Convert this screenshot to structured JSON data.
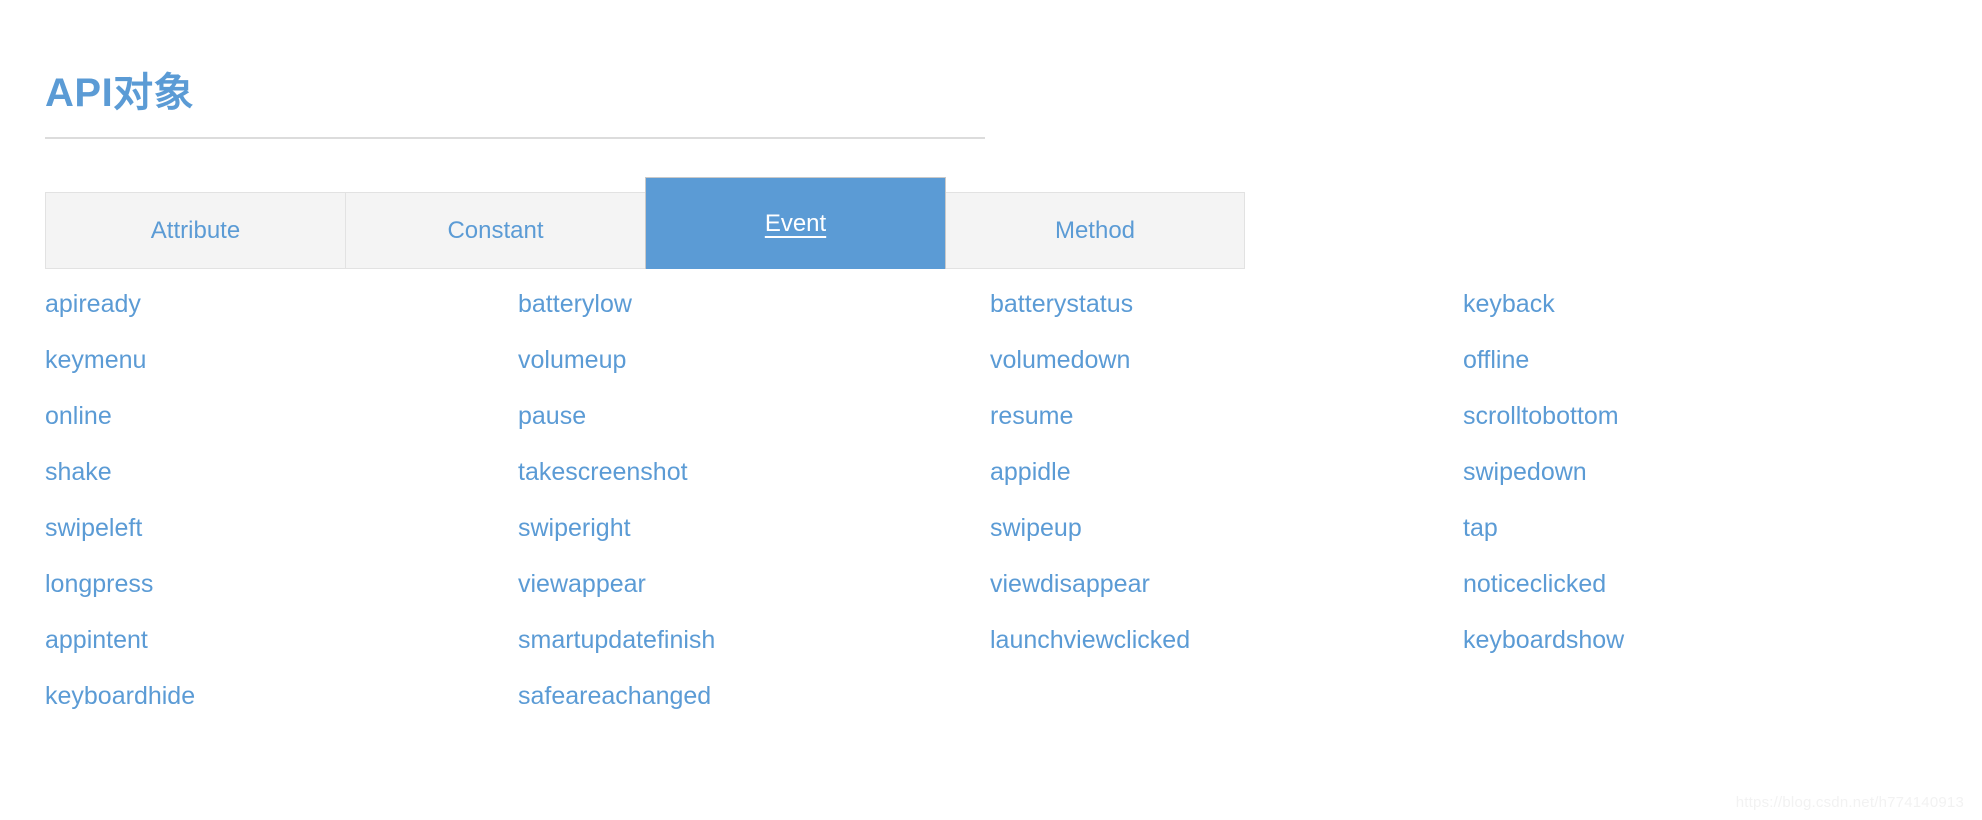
{
  "header": {
    "title": "API对象",
    "title_color": "#5b9bd5",
    "rule_color": "#dcdcdc"
  },
  "tabs": {
    "active_index": 2,
    "active_bg": "#5b9bd5",
    "inactive_bg": "#f4f4f4",
    "items": [
      {
        "label": "Attribute"
      },
      {
        "label": "Constant"
      },
      {
        "label": "Event"
      },
      {
        "label": "Method"
      }
    ]
  },
  "event_list": {
    "columns": [
      {
        "items": [
          {
            "label": "apiready"
          },
          {
            "label": "keymenu"
          },
          {
            "label": "online"
          },
          {
            "label": "shake"
          },
          {
            "label": "swipeleft"
          },
          {
            "label": "longpress"
          },
          {
            "label": "appintent"
          },
          {
            "label": "keyboardhide"
          }
        ]
      },
      {
        "items": [
          {
            "label": "batterylow"
          },
          {
            "label": "volumeup"
          },
          {
            "label": "pause"
          },
          {
            "label": "takescreenshot"
          },
          {
            "label": "swiperight"
          },
          {
            "label": "viewappear"
          },
          {
            "label": "smartupdatefinish"
          },
          {
            "label": "safeareachanged"
          }
        ]
      },
      {
        "items": [
          {
            "label": "batterystatus"
          },
          {
            "label": "volumedown"
          },
          {
            "label": "resume"
          },
          {
            "label": "appidle"
          },
          {
            "label": "swipeup"
          },
          {
            "label": "viewdisappear"
          },
          {
            "label": "launchviewclicked"
          }
        ]
      },
      {
        "items": [
          {
            "label": "keyback"
          },
          {
            "label": "offline"
          },
          {
            "label": "scrolltobottom"
          },
          {
            "label": "swipedown"
          },
          {
            "label": "tap"
          },
          {
            "label": "noticeclicked"
          },
          {
            "label": "keyboardshow"
          }
        ]
      }
    ]
  },
  "watermark": {
    "text": "https://blog.csdn.net/h774140913"
  }
}
